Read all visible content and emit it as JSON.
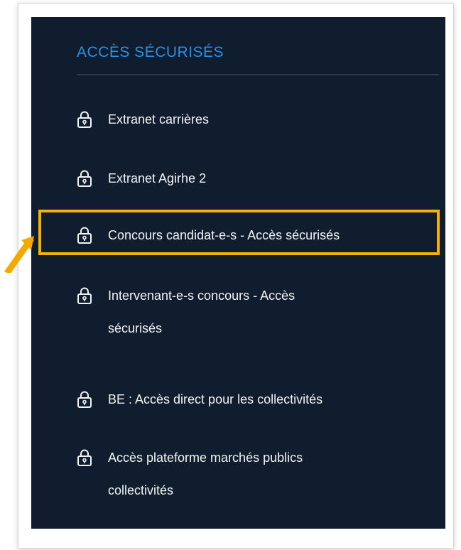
{
  "panel": {
    "title": "ACCÈS SÉCURISÉS",
    "items": [
      {
        "icon": "lock-icon",
        "label": "Extranet carrières",
        "label2": ""
      },
      {
        "icon": "lock-icon",
        "label": "Extranet Agirhe 2",
        "label2": ""
      },
      {
        "icon": "lock-icon",
        "label": "Concours candidat-e-s - Accès sécurisés",
        "label2": "",
        "highlighted": true
      },
      {
        "icon": "lock-icon",
        "label": "Intervenant-e-s concours - Accès",
        "label2": "sécurisés"
      },
      {
        "icon": "lock-icon",
        "label": "BE : Accès direct pour les collectivités",
        "label2": ""
      },
      {
        "icon": "lock-icon",
        "label": "Accès plateforme marchés publics",
        "label2": "collectivités"
      }
    ]
  },
  "colors": {
    "panel_bg": "#0f1d2e",
    "title": "#2d8fe0",
    "text": "#f2f4f6",
    "highlight": "#f5b300"
  }
}
